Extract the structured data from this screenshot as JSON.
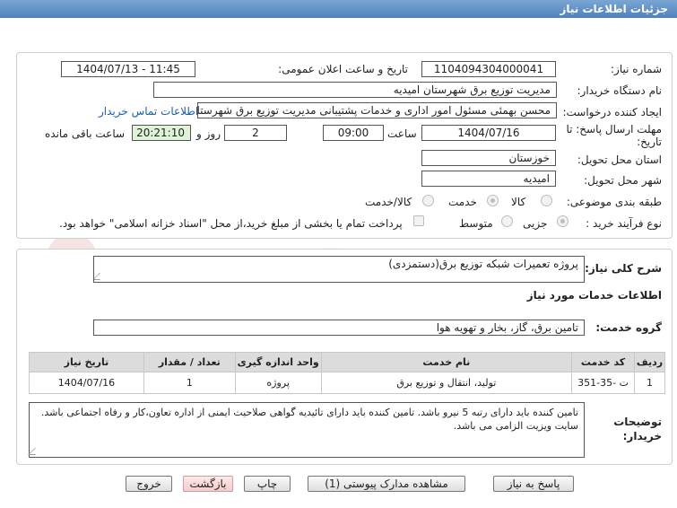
{
  "header": {
    "title": "جزئیات اطلاعات نیاز"
  },
  "form": {
    "need_number": {
      "label": "شماره نیاز:",
      "value": "1104094304000041"
    },
    "announce_datetime": {
      "label": "تاریخ و ساعت اعلان عمومی:",
      "value": "1404/07/13 - 11:45"
    },
    "buyer_org": {
      "label": "نام دستگاه خریدار:",
      "value": "مدیریت توزیع برق شهرستان امیدیه"
    },
    "requester": {
      "label": "ایجاد کننده درخواست:",
      "value": "محسن بهمئی مسئول امور اداری و خدمات پشتیبانی مدیریت توزیع برق شهرستان",
      "contact_link": "اطلاعات تماس خریدار"
    },
    "deadline": {
      "label_line1": "مهلت ارسال پاسخ: تا",
      "label_line2": "تاریخ:",
      "date": "1404/07/16",
      "time_label": "ساعت",
      "time": "09:00",
      "days": "2",
      "days_label": "روز و",
      "remaining": "20:21:10",
      "remaining_label": "ساعت باقی مانده"
    },
    "province": {
      "label": "استان محل تحویل:",
      "value": "خوزستان"
    },
    "city": {
      "label": "شهر محل تحویل:",
      "value": "امیدیه"
    },
    "category": {
      "label": "طبقه بندی موضوعی:",
      "options": [
        "کالا",
        "خدمت",
        "کالا/خدمت"
      ],
      "selected": "خدمت"
    },
    "process": {
      "label": "نوع فرآیند خرید :",
      "options": [
        "جزیی",
        "متوسط"
      ],
      "selected": "جزیی",
      "payment_note": "پرداخت تمام یا بخشی از مبلغ خرید،از محل \"اسناد خزانه اسلامی\" خواهد بود."
    }
  },
  "need_summary": {
    "label": "شرح کلی نیاز:",
    "value": "پروژه تعمیرات شبکه توزیع برق(دستمزدی)"
  },
  "services": {
    "section_title": "اطلاعات خدمات مورد نیاز",
    "group_label": "گروه خدمت:",
    "group_value": "تامین برق، گاز، بخار و تهویه هوا",
    "table": {
      "headers": [
        "ردیف",
        "کد خدمت",
        "نام خدمت",
        "واحد اندازه گیری",
        "تعداد / مقدار",
        "تاریخ نیاز"
      ],
      "rows": [
        [
          "1",
          "ت -35-351",
          "تولید، انتقال و توزیع برق",
          "پروژه",
          "1",
          "1404/07/16"
        ]
      ]
    }
  },
  "buyer_notes": {
    "label_line1": "توضیحات",
    "label_line2": "خریدار:",
    "value": "تامین کننده باید دارای رتبه 5 نیرو باشد. تامین کننده باید دارای تائیدیه گواهی صلاحیت ایمنی از اداره تعاون،کار و رفاه اجتماعی باشد. سایت ویزیت الزامی می باشد."
  },
  "buttons": {
    "reply": "پاسخ به نیاز",
    "attachments": "مشاهده مدارک پیوستی (1)",
    "print": "چاپ",
    "back": "بازگشت",
    "exit": "خروج"
  },
  "watermark": {
    "text": "AriaTender.net"
  }
}
